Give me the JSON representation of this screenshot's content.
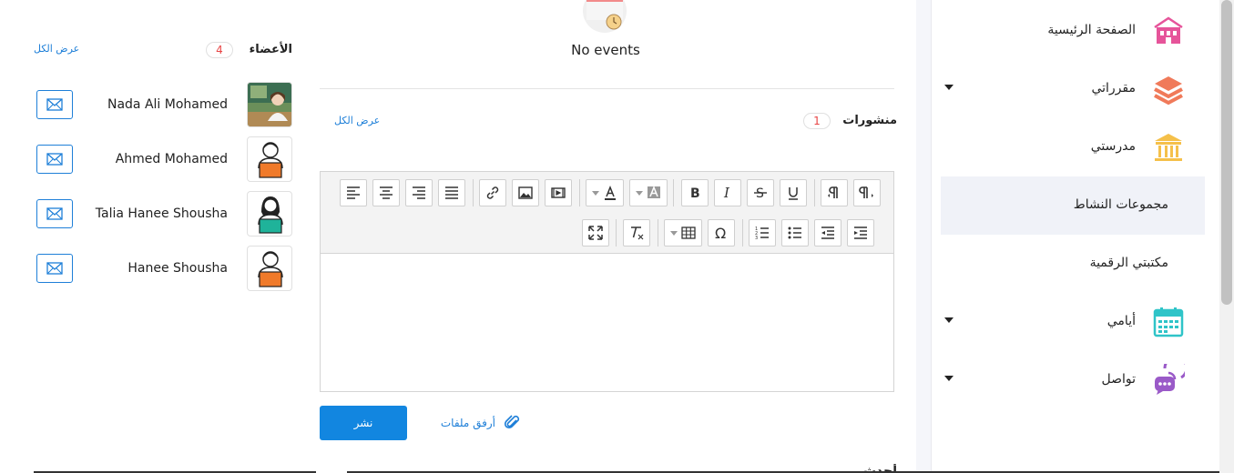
{
  "sidebar": {
    "items": [
      {
        "label": "الصفحة الرئيسية",
        "icon": "school-building-icon",
        "color": "#e6549a",
        "has_caret": false,
        "active": false
      },
      {
        "label": "مقرراتي",
        "icon": "books-stack-icon",
        "color": "#f07a5a",
        "has_caret": true,
        "active": false
      },
      {
        "label": "مدرستي",
        "icon": "institution-icon",
        "color": "#f5c04a",
        "has_caret": false,
        "active": false
      },
      {
        "label": "مجموعات النشاط",
        "icon": "",
        "has_caret": false,
        "active": true
      },
      {
        "label": "مكتبتي الرقمية",
        "icon": "",
        "has_caret": false,
        "active": false
      },
      {
        "label": "أيامي",
        "icon": "calendar-icon",
        "color": "#2fc4c8",
        "has_caret": true,
        "active": false
      },
      {
        "label": "تواصل",
        "icon": "chat-bubbles-icon",
        "color": "#9a5ac8",
        "has_caret": true,
        "active": false
      }
    ]
  },
  "events": {
    "empty_text": "No events"
  },
  "posts": {
    "title": "منشورات",
    "count": "1",
    "view_all": "عرض الكل",
    "publish_label": "نشر",
    "attach_label": "أرفق ملفات",
    "section_heading_partial": "أحدث المنشورات"
  },
  "members": {
    "title": "الأعضاء",
    "count": "4",
    "view_all": "عرض الكل",
    "list": [
      {
        "name": "Nada Ali Mohamed",
        "avatar": "photo"
      },
      {
        "name": "Ahmed Mohamed",
        "avatar": "male-student-icon"
      },
      {
        "name": "Talia Hanee Shousha",
        "avatar": "female-student-icon"
      },
      {
        "name": "Hanee Shousha",
        "avatar": "male-student-icon"
      }
    ]
  },
  "colors": {
    "accent": "#1286e0",
    "badge_text": "#e84545",
    "link": "#1e7fd8"
  }
}
